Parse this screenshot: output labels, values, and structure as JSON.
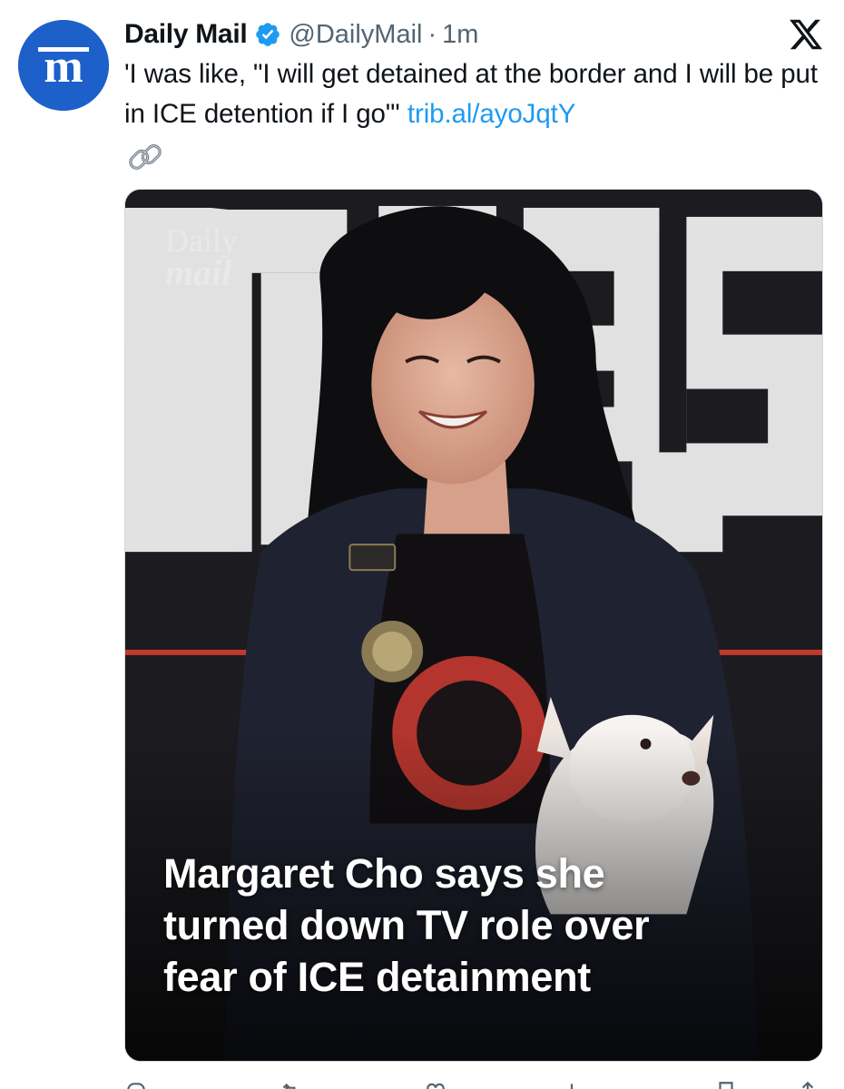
{
  "account": {
    "display_name": "Daily Mail",
    "handle": "@DailyMail",
    "separator": "·",
    "time": "1m",
    "avatar_icon": "daily-mail-logo-icon",
    "avatar_color": "#1d60c9",
    "verified_icon": "verified-badge-icon",
    "verified_color": "#1d9bf0"
  },
  "platform_icon": "x-logo-icon",
  "tweet": {
    "text": "'I was like, \"I will get detained at the border and I will be put in ICE detention if I go\"'",
    "link_text": "trib.al/ayoJqtY",
    "link_color": "#1d9bf0",
    "trailing_icon": "link-chain-icon"
  },
  "media": {
    "watermark_top": "Daily",
    "watermark_bottom": "mail",
    "backdrop_letters": "RTES",
    "headline_lines": [
      "Margaret Cho says she",
      "turned down TV role over",
      "fear of ICE detainment"
    ]
  },
  "actions": [
    "reply-icon",
    "retweet-icon",
    "like-icon",
    "views-icon",
    "bookmark-icon",
    "share-icon"
  ]
}
